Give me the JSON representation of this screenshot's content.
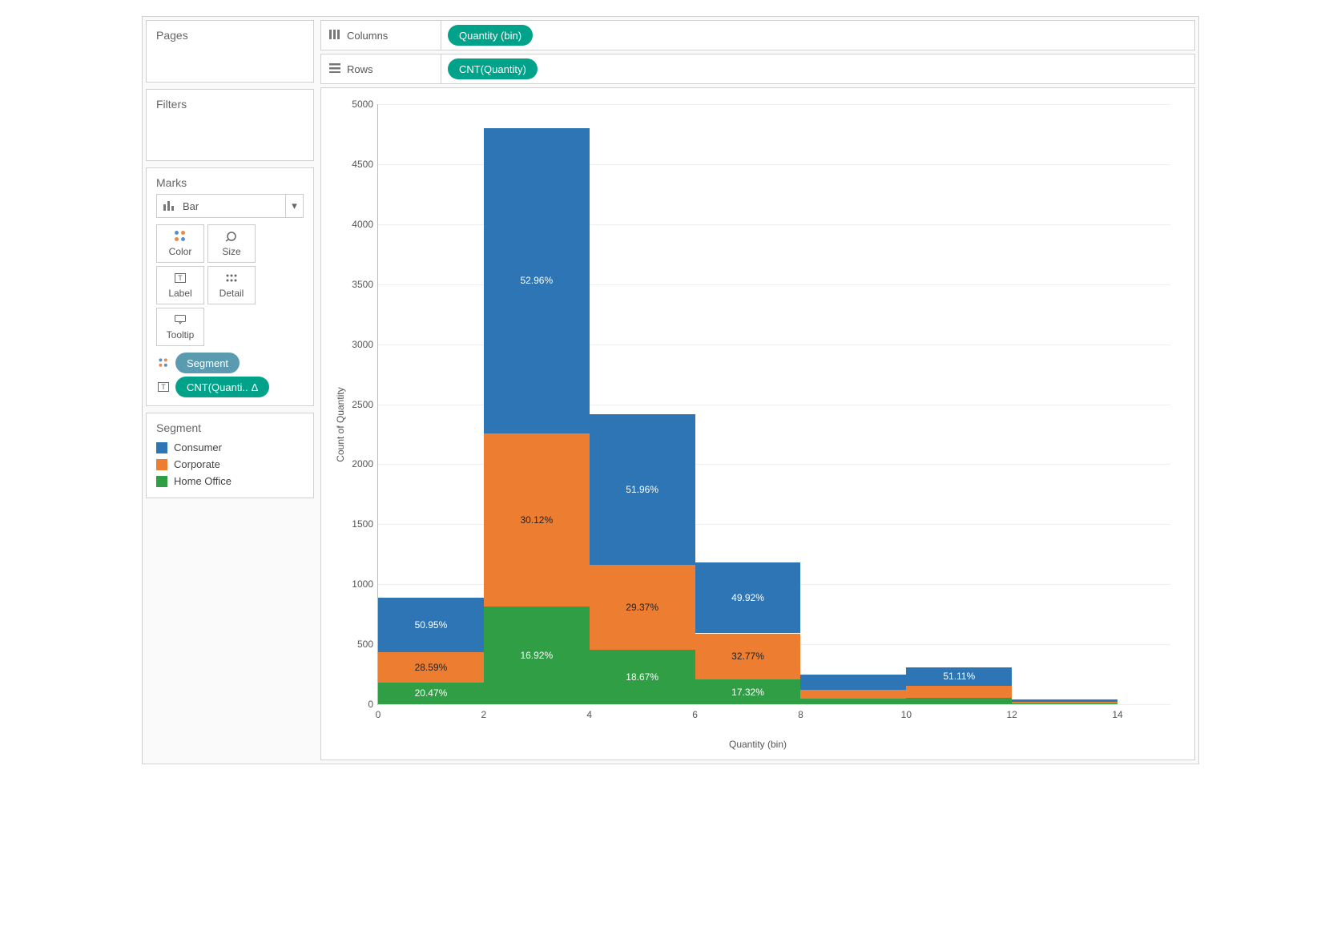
{
  "shelves": {
    "columns_label": "Columns",
    "rows_label": "Rows",
    "columns_pill": "Quantity (bin)",
    "rows_pill": "CNT(Quantity)"
  },
  "panels": {
    "pages": "Pages",
    "filters": "Filters",
    "marks": "Marks",
    "segment_title": "Segment"
  },
  "marks": {
    "type": "Bar",
    "buttons": {
      "color": "Color",
      "size": "Size",
      "label": "Label",
      "detail": "Detail",
      "tooltip": "Tooltip"
    },
    "color_pill": "Segment",
    "label_pill": "CNT(Quanti.. ",
    "label_pill_delta": "Δ"
  },
  "legend": [
    {
      "name": "Consumer",
      "color": "#2e75b6"
    },
    {
      "name": "Corporate",
      "color": "#ed7d31"
    },
    {
      "name": "Home Office",
      "color": "#2f9e44"
    }
  ],
  "chart_data": {
    "type": "bar",
    "stacked": true,
    "xlabel": "Quantity (bin)",
    "ylabel": "Count of Quantity",
    "ylim": [
      0,
      5000
    ],
    "yticks": [
      0,
      500,
      1000,
      1500,
      2000,
      2500,
      3000,
      3500,
      4000,
      4500,
      5000
    ],
    "xticks": [
      0,
      2,
      4,
      6,
      8,
      10,
      12,
      14
    ],
    "bin_edges": [
      0,
      2,
      4,
      6,
      8,
      10,
      12,
      14
    ],
    "series": [
      {
        "name": "Consumer",
        "color": "#2e75b6"
      },
      {
        "name": "Corporate",
        "color": "#ed7d31"
      },
      {
        "name": "Home Office",
        "color": "#2f9e44"
      }
    ],
    "bars": [
      {
        "bin": 0,
        "total": 890,
        "segments": [
          {
            "series": "Home Office",
            "pct": 20.47,
            "value": 182,
            "label": "20.47%",
            "label_color": "light"
          },
          {
            "series": "Corporate",
            "pct": 28.59,
            "value": 254,
            "label": "28.59%",
            "label_color": "dark"
          },
          {
            "series": "Consumer",
            "pct": 50.95,
            "value": 454,
            "label": "50.95%",
            "label_color": "light"
          }
        ]
      },
      {
        "bin": 2,
        "total": 4800,
        "segments": [
          {
            "series": "Home Office",
            "pct": 16.92,
            "value": 812,
            "label": "16.92%",
            "label_color": "light"
          },
          {
            "series": "Corporate",
            "pct": 30.12,
            "value": 1446,
            "label": "30.12%",
            "label_color": "dark"
          },
          {
            "series": "Consumer",
            "pct": 52.96,
            "value": 2542,
            "label": "52.96%",
            "label_color": "light"
          }
        ]
      },
      {
        "bin": 4,
        "total": 2420,
        "segments": [
          {
            "series": "Home Office",
            "pct": 18.67,
            "value": 452,
            "label": "18.67%",
            "label_color": "light"
          },
          {
            "series": "Corporate",
            "pct": 29.37,
            "value": 711,
            "label": "29.37%",
            "label_color": "dark"
          },
          {
            "series": "Consumer",
            "pct": 51.96,
            "value": 1257,
            "label": "51.96%",
            "label_color": "light"
          }
        ]
      },
      {
        "bin": 6,
        "total": 1180,
        "segments": [
          {
            "series": "Home Office",
            "pct": 17.32,
            "value": 204,
            "label": "17.32%",
            "label_color": "light"
          },
          {
            "series": "Corporate",
            "pct": 32.77,
            "value": 387,
            "label": "32.77%",
            "label_color": "dark"
          },
          {
            "series": "Consumer",
            "pct": 49.92,
            "value": 589,
            "label": "49.92%",
            "label_color": "light"
          }
        ]
      },
      {
        "bin": 8,
        "total": 250,
        "segments": [
          {
            "series": "Home Office",
            "pct": 18.0,
            "value": 45,
            "label": "",
            "label_color": "light"
          },
          {
            "series": "Corporate",
            "pct": 31.0,
            "value": 78,
            "label": "",
            "label_color": "dark"
          },
          {
            "series": "Consumer",
            "pct": 51.0,
            "value": 127,
            "label": "",
            "label_color": "light"
          }
        ]
      },
      {
        "bin": 10,
        "total": 310,
        "segments": [
          {
            "series": "Home Office",
            "pct": 17.0,
            "value": 53,
            "label": "",
            "label_color": "light"
          },
          {
            "series": "Corporate",
            "pct": 31.89,
            "value": 99,
            "label": "",
            "label_color": "dark"
          },
          {
            "series": "Consumer",
            "pct": 51.11,
            "value": 158,
            "label": "51.11%",
            "label_color": "light"
          }
        ]
      },
      {
        "bin": 12,
        "total": 40,
        "segments": [
          {
            "series": "Home Office",
            "pct": 18.0,
            "value": 7,
            "label": "",
            "label_color": "light"
          },
          {
            "series": "Corporate",
            "pct": 31.0,
            "value": 12,
            "label": "",
            "label_color": "dark"
          },
          {
            "series": "Consumer",
            "pct": 51.0,
            "value": 21,
            "label": "",
            "label_color": "light"
          }
        ]
      }
    ]
  }
}
